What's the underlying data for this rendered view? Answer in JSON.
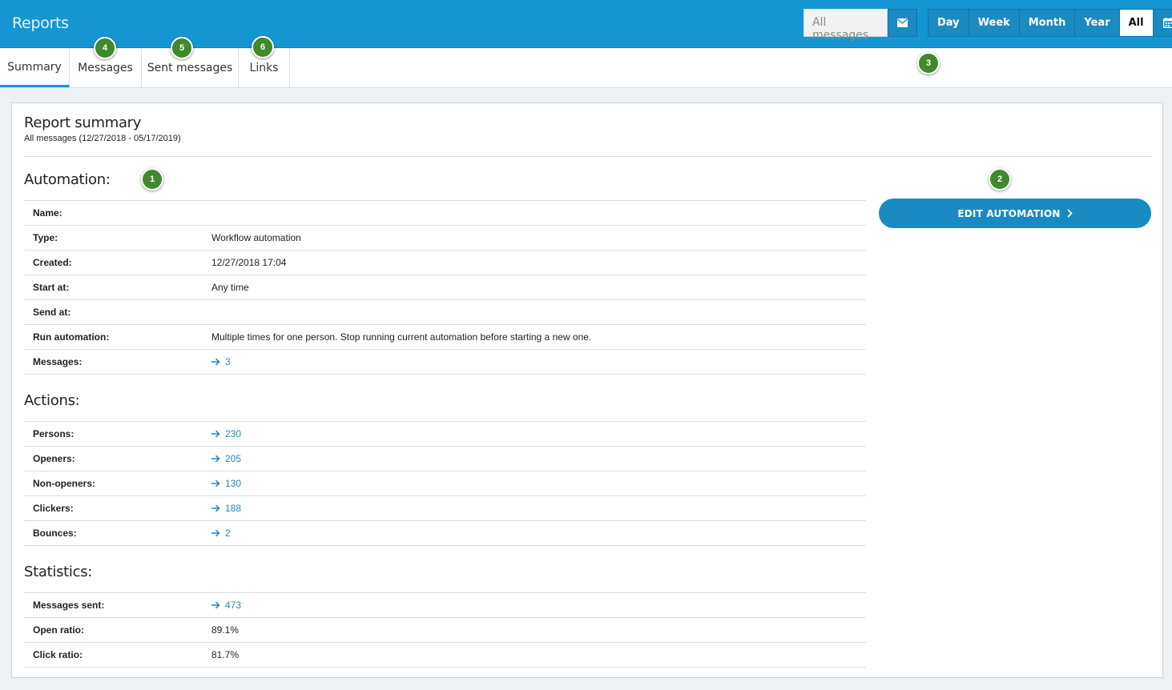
{
  "header": {
    "title": "Reports",
    "filter": {
      "value": "All messages",
      "button_icon": "envelope-icon"
    },
    "periods": [
      "Day",
      "Week",
      "Month",
      "Year",
      "All"
    ],
    "active_period": "All",
    "calendar_icon": "calendar-icon",
    "accent_color": "#1596d2"
  },
  "tabs": [
    "Summary",
    "Messages",
    "Sent messages",
    "Links"
  ],
  "active_tab": "Summary",
  "badges": [
    "1",
    "2",
    "3",
    "4",
    "5",
    "6"
  ],
  "badge_color": "#3f8a2a",
  "summary": {
    "title": "Report summary",
    "subtitle": "All messages (12/27/2018 - 05/17/2019)"
  },
  "automation": {
    "title": "Automation:",
    "rows": [
      {
        "label": "Name:",
        "value": ""
      },
      {
        "label": "Type:",
        "value": "Workflow automation"
      },
      {
        "label": "Created:",
        "value": "12/27/2018 17:04"
      },
      {
        "label": "Start at:",
        "value": "Any time"
      },
      {
        "label": "Send at:",
        "value": ""
      },
      {
        "label": "Run automation:",
        "value": "Multiple times for one person. Stop running current automation before starting a new one."
      },
      {
        "label": "Messages:",
        "value": "3"
      }
    ]
  },
  "actions": {
    "title": "Actions:",
    "rows": [
      {
        "label": "Persons:",
        "value": "230"
      },
      {
        "label": "Openers:",
        "value": "205"
      },
      {
        "label": "Non-openers:",
        "value": "130"
      },
      {
        "label": "Clickers:",
        "value": "188"
      },
      {
        "label": "Bounces:",
        "value": "2"
      }
    ]
  },
  "statistics": {
    "title": "Statistics:",
    "rows": [
      {
        "label": "Messages sent:",
        "value": "473"
      },
      {
        "label": "Open ratio:",
        "value": "89.1%"
      },
      {
        "label": "Click ratio:",
        "value": "81.7%"
      }
    ]
  },
  "edit_button": {
    "label": "EDIT AUTOMATION",
    "icon": "chevron-right-icon"
  }
}
